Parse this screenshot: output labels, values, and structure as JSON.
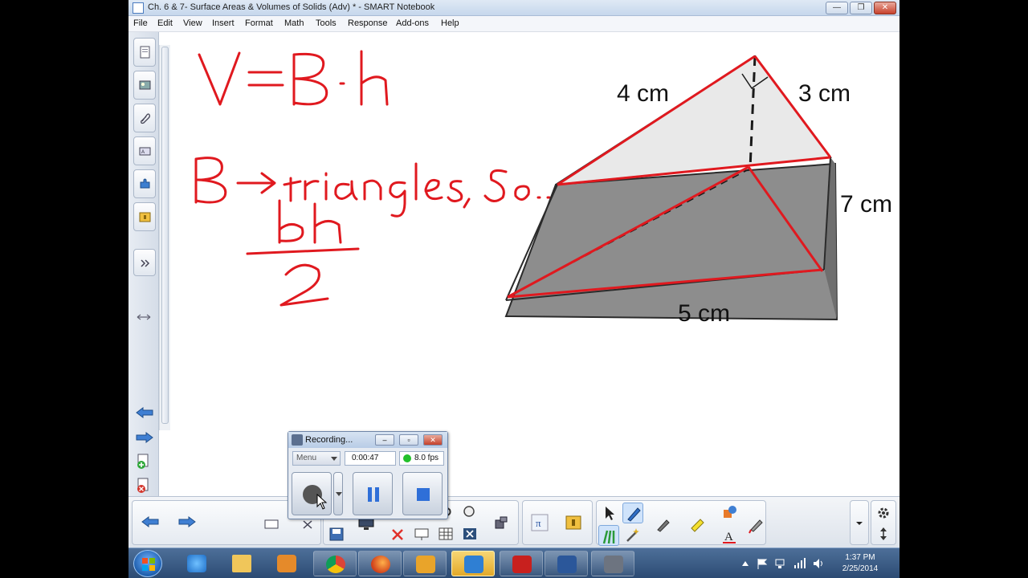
{
  "window": {
    "title": "Ch. 6 & 7- Surface Areas & Volumes of Solids (Adv) * - SMART Notebook",
    "minimize": "—",
    "maximize": "❐",
    "close": "✕"
  },
  "menu": {
    "items": [
      "File",
      "Edit",
      "View",
      "Insert",
      "Format",
      "Math",
      "Tools",
      "Response",
      "Add-ons",
      "Help"
    ]
  },
  "canvas": {
    "ink_formula": "V=B·h",
    "ink_note": "B→ triangles, So...",
    "ink_fraction_numerator": "bh",
    "ink_fraction_denominator": "2",
    "prism_labels": {
      "left_top": "4 cm",
      "right_top": "3 cm",
      "height": "7 cm",
      "base": "5 cm"
    },
    "ink_color": "#e0191f"
  },
  "recorder": {
    "title": "Recording...",
    "menu_label": "Menu",
    "elapsed": "0:00:47",
    "fps": "8.0 fps",
    "status_color": "#22c02a"
  },
  "taskbar": {
    "time": "1:37 PM",
    "date": "2/25/2014"
  },
  "icons": {
    "page_sorter": "page-sorter-icon",
    "gallery": "gallery-icon",
    "attachments": "paperclip-icon",
    "properties": "properties-icon",
    "addons": "puzzle-icon",
    "lesson": "lesson-icon"
  }
}
